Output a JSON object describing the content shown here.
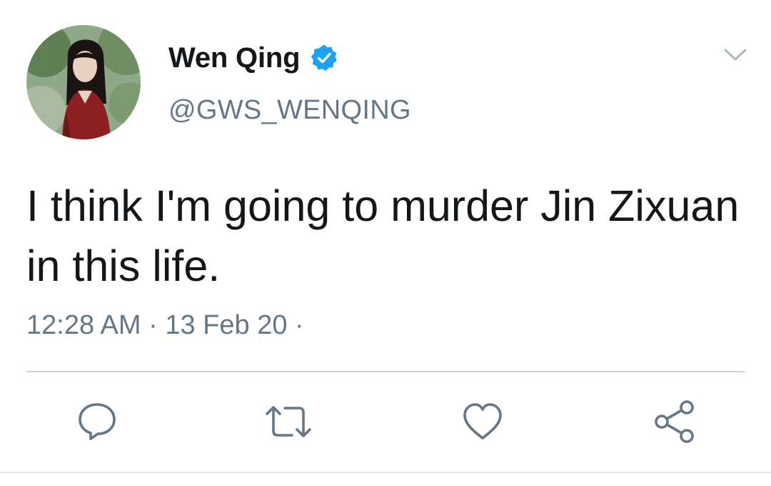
{
  "tweet": {
    "author": {
      "display_name": "Wen Qing",
      "handle": "@GWS_WENQING",
      "verified": true,
      "avatar_icon": "profile-photo"
    },
    "text": "I think I'm going to murder Jin Zixuan in this life.",
    "time": "12:28 AM",
    "date": "13 Feb 20",
    "separator": "·"
  },
  "actions": [
    {
      "name": "reply",
      "icon": "reply-icon"
    },
    {
      "name": "retweet",
      "icon": "retweet-icon"
    },
    {
      "name": "like",
      "icon": "heart-icon"
    },
    {
      "name": "share",
      "icon": "share-icon"
    }
  ],
  "colors": {
    "text_primary": "#14171a",
    "text_secondary": "#657786",
    "verified_blue": "#1da1f2",
    "icon_gray": "#657786",
    "divider": "#ccd6dd"
  }
}
